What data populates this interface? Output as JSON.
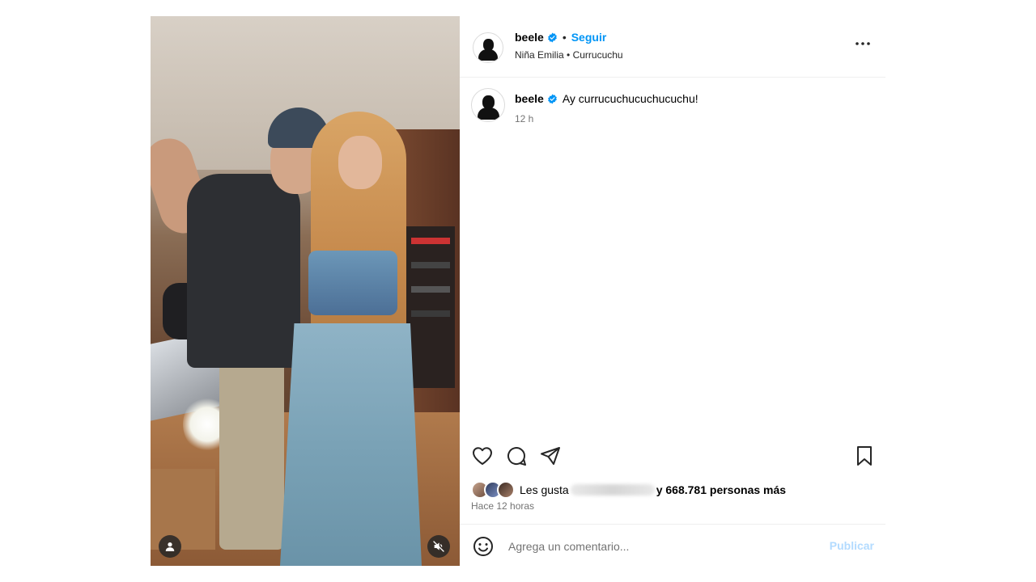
{
  "post": {
    "username": "beele",
    "follow_label": "Seguir",
    "dot": "•",
    "audio": {
      "artist": "Niña Emilia",
      "separator": "•",
      "title": "Currucuchu"
    }
  },
  "caption": {
    "username": "beele",
    "text": "Ay currucuchucuchucuchu!",
    "time": "12 h"
  },
  "likes": {
    "prefix": "Les gusta",
    "count_text": "y 668.781 personas más",
    "time_ago": "Hace 12 horas"
  },
  "comment": {
    "placeholder": "Agrega un comentario...",
    "publish_label": "Publicar"
  },
  "icons": {
    "verified": "verified-badge-icon",
    "more": "more-options-icon",
    "like": "heart-icon",
    "comment": "comment-bubble-icon",
    "share": "paper-plane-icon",
    "save": "bookmark-icon",
    "emoji": "emoji-smile-icon",
    "user_tag": "user-tag-icon",
    "mute": "speaker-muted-icon"
  },
  "colors": {
    "accent": "#0095f6",
    "publish_disabled": "#b3dbff",
    "muted_text": "#737373"
  }
}
